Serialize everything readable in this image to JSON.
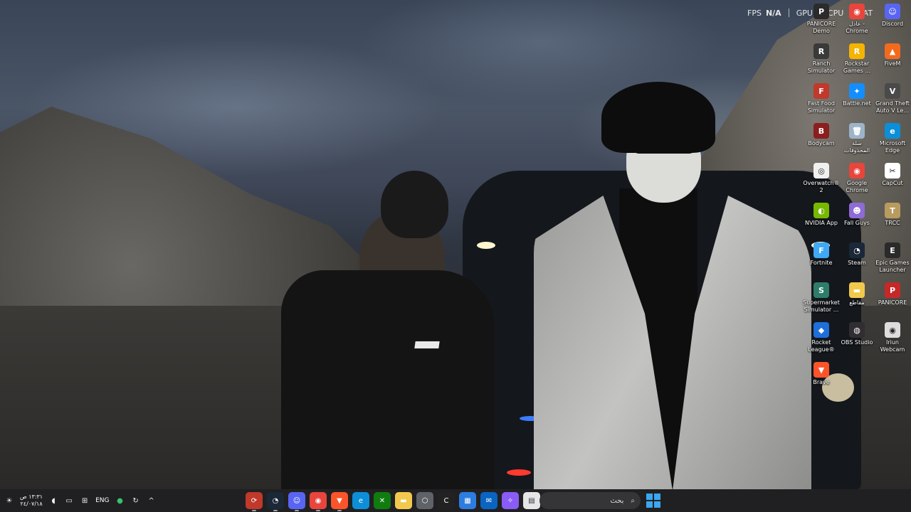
{
  "perf_overlay": {
    "fps_label": "FPS",
    "fps_value": "N/A",
    "gpu_label": "GPU",
    "cpu_label": "CPU",
    "lat_label": "LAT"
  },
  "desktop_icons": [
    {
      "label": "PANICORE Demo",
      "icon": "panicore-icon",
      "color": "#2b2b2b",
      "glyph": "P"
    },
    {
      "label": "عادل - Chrome",
      "icon": "chrome-icon",
      "color": "#e8453c",
      "glyph": "◉"
    },
    {
      "label": "Discord",
      "icon": "discord-icon",
      "color": "#5865f2",
      "glyph": "☺"
    },
    {
      "label": "Ranch Simulator",
      "icon": "ranch-simulator-icon",
      "color": "#3a3a3a",
      "glyph": "R"
    },
    {
      "label": "Rockstar Games ...",
      "icon": "rockstar-icon",
      "color": "#f4b400",
      "glyph": "R"
    },
    {
      "label": "FiveM",
      "icon": "fivem-icon",
      "color": "#f26b1d",
      "glyph": "▲"
    },
    {
      "label": "Fast Food Simulator",
      "icon": "fast-food-simulator-icon",
      "color": "#c0392b",
      "glyph": "F"
    },
    {
      "label": "Battle.net",
      "icon": "battlenet-icon",
      "color": "#148eff",
      "glyph": "✦"
    },
    {
      "label": "Grand Theft Auto V Le...",
      "icon": "gta-v-icon",
      "color": "#4a4a4a",
      "glyph": "V"
    },
    {
      "label": "Bodycam",
      "icon": "bodycam-icon",
      "color": "#8b1e1e",
      "glyph": "B"
    },
    {
      "label": "سلة المحذوفات",
      "icon": "recycle-bin-icon",
      "color": "#9db4c8",
      "glyph": "🗑"
    },
    {
      "label": "Microsoft Edge",
      "icon": "edge-icon",
      "color": "#0c8fd8",
      "glyph": "e"
    },
    {
      "label": "Overwatch® 2",
      "icon": "overwatch-icon",
      "color": "#f0f0f0",
      "glyph": "◎"
    },
    {
      "label": "Google Chrome",
      "icon": "chrome-icon",
      "color": "#e8453c",
      "glyph": "◉"
    },
    {
      "label": "CapCut",
      "icon": "capcut-icon",
      "color": "#ffffff",
      "glyph": "✂"
    },
    {
      "label": "NVIDIA App",
      "icon": "nvidia-icon",
      "color": "#76b900",
      "glyph": "◐"
    },
    {
      "label": "Fall Guys",
      "icon": "fall-guys-icon",
      "color": "#8e6bd6",
      "glyph": "☻"
    },
    {
      "label": "TRCC",
      "icon": "trcc-icon",
      "color": "#b89b5e",
      "glyph": "T"
    },
    {
      "label": "Fortnite",
      "icon": "fortnite-icon",
      "color": "#3fa9f5",
      "glyph": "F"
    },
    {
      "label": "Steam",
      "icon": "steam-icon",
      "color": "#1b2838",
      "glyph": "◔"
    },
    {
      "label": "Epic Games Launcher",
      "icon": "epic-games-icon",
      "color": "#2a2a2a",
      "glyph": "E"
    },
    {
      "label": "Supermarket Simulator ...",
      "icon": "supermarket-simulator-icon",
      "color": "#2e7d6b",
      "glyph": "S"
    },
    {
      "label": "مقاطع",
      "icon": "folder-icon",
      "color": "#f2c94c",
      "glyph": "▬"
    },
    {
      "label": "PANICORE",
      "icon": "panicore-icon",
      "color": "#c62828",
      "glyph": "P"
    },
    {
      "label": "Rocket League®",
      "icon": "rocket-league-icon",
      "color": "#1e6fd9",
      "glyph": "◆"
    },
    {
      "label": "OBS Studio",
      "icon": "obs-icon",
      "color": "#302e31",
      "glyph": "◍"
    },
    {
      "label": "Iriun Webcam",
      "icon": "iriun-webcam-icon",
      "color": "#dddddd",
      "glyph": "◉"
    },
    {
      "label": "Brave",
      "icon": "brave-icon",
      "color": "#fb542b",
      "glyph": "▼"
    }
  ],
  "taskbar": {
    "clock_time": "١٣:٣١ ص",
    "clock_date": "٢٤/٠٧/١٨",
    "language": "ENG",
    "search_placeholder": "بحث",
    "apps": [
      {
        "icon": "cleaner-icon",
        "color": "#c0392b",
        "glyph": "⟳",
        "running": true
      },
      {
        "icon": "steam-icon",
        "color": "#1b2838",
        "glyph": "◔",
        "running": true
      },
      {
        "icon": "discord-icon",
        "color": "#5865f2",
        "glyph": "☺",
        "running": true
      },
      {
        "icon": "chrome-icon",
        "color": "#e8453c",
        "glyph": "◉",
        "running": true
      },
      {
        "icon": "brave-icon",
        "color": "#fb542b",
        "glyph": "▼",
        "running": true
      },
      {
        "icon": "edge-icon",
        "color": "#0c8fd8",
        "glyph": "e",
        "running": false
      },
      {
        "icon": "xbox-icon",
        "color": "#107c10",
        "glyph": "✕",
        "running": false
      },
      {
        "icon": "file-explorer-icon",
        "color": "#f2c94c",
        "glyph": "▬",
        "running": false
      },
      {
        "icon": "settings-icon",
        "color": "#5f6368",
        "glyph": "⬡",
        "running": false
      },
      {
        "icon": "ctrl-app-icon",
        "color": "#222222",
        "glyph": "C",
        "running": false
      },
      {
        "icon": "store-icon",
        "color": "#2d7de0",
        "glyph": "▦",
        "running": false
      },
      {
        "icon": "outlook-icon",
        "color": "#0a64c2",
        "glyph": "✉",
        "running": false
      },
      {
        "icon": "copilot-icon",
        "color": "#8a5cf6",
        "glyph": "✧",
        "running": false
      },
      {
        "icon": "notepad-icon",
        "color": "#e6e6e6",
        "glyph": "▤",
        "running": false
      }
    ]
  }
}
